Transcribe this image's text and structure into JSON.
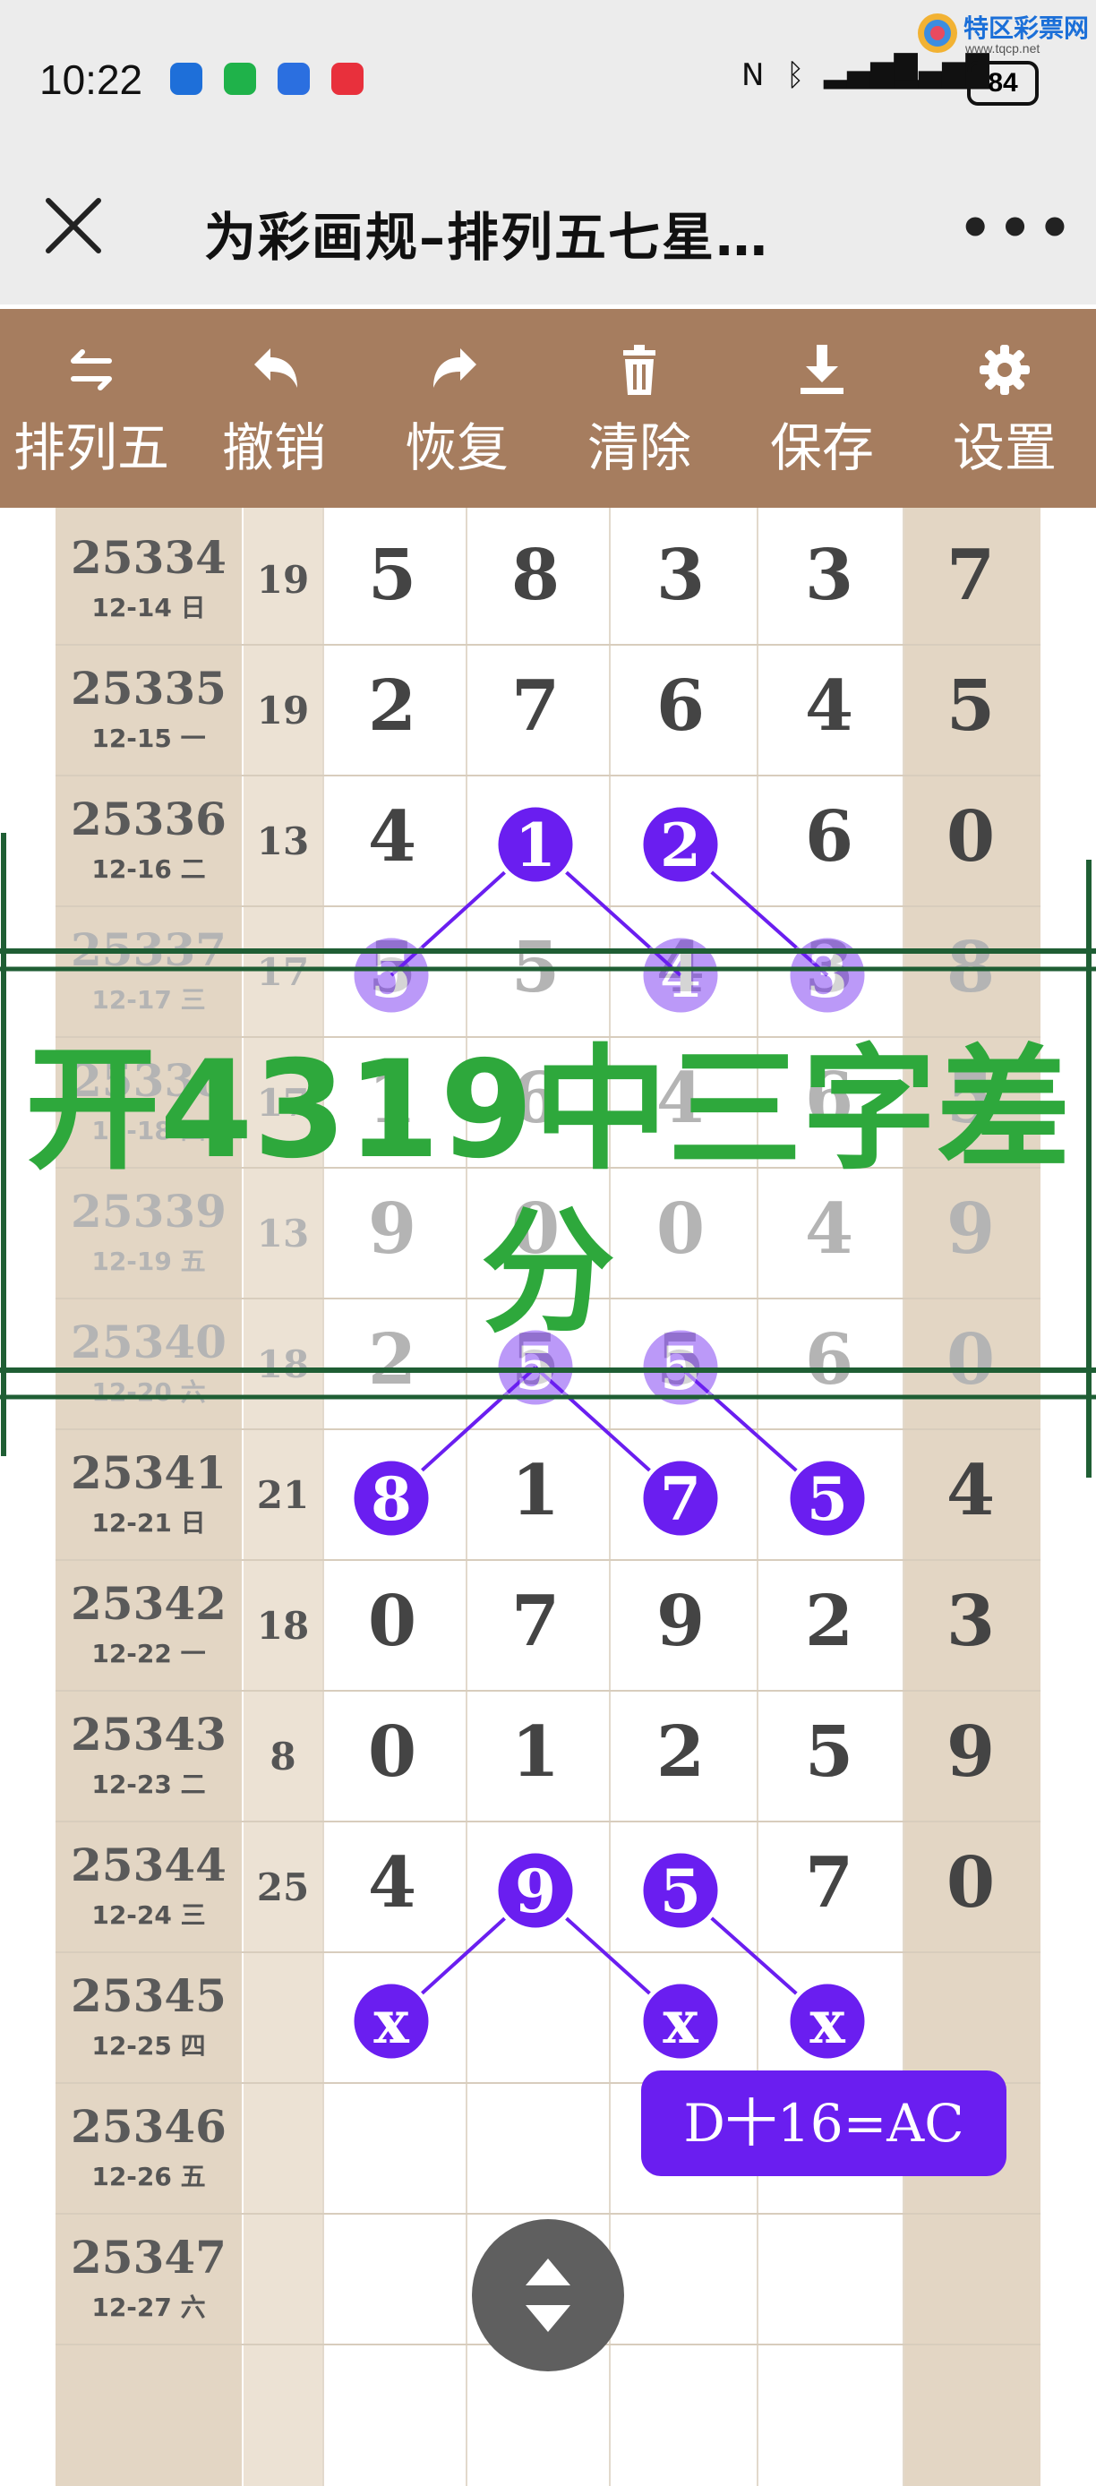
{
  "status": {
    "time": "10:22",
    "battery": "84"
  },
  "watermark": {
    "name": "特区彩票网",
    "url": "www.tqcp.net"
  },
  "header": {
    "title": "为彩画规–排列五七星…",
    "more": "•••"
  },
  "toolbar": [
    {
      "icon": "swap-icon",
      "label": "排列五"
    },
    {
      "icon": "undo-icon",
      "label": "撤销"
    },
    {
      "icon": "redo-icon",
      "label": "恢复"
    },
    {
      "icon": "trash-icon",
      "label": "清除"
    },
    {
      "icon": "download-icon",
      "label": "保存"
    },
    {
      "icon": "gear-icon",
      "label": "设置"
    }
  ],
  "rows": [
    {
      "issue": "25334",
      "date": "12-14 日",
      "sum": "19",
      "digits": [
        "5",
        "8",
        "3",
        "3",
        "7"
      ]
    },
    {
      "issue": "25335",
      "date": "12-15 一",
      "sum": "19",
      "digits": [
        "2",
        "7",
        "6",
        "4",
        "5"
      ]
    },
    {
      "issue": "25336",
      "date": "12-16 二",
      "sum": "13",
      "digits": [
        "4",
        "1",
        "2",
        "6",
        "0"
      ]
    },
    {
      "issue": "25337",
      "date": "12-17 三",
      "sum": "17",
      "digits": [
        "5",
        "5",
        "4",
        "3",
        "8"
      ]
    },
    {
      "issue": "25338",
      "date": "12-18 四",
      "sum": "17",
      "digits": [
        "1",
        "6",
        "4",
        "6",
        "5"
      ]
    },
    {
      "issue": "25339",
      "date": "12-19 五",
      "sum": "13",
      "digits": [
        "9",
        "0",
        "0",
        "4",
        "9"
      ]
    },
    {
      "issue": "25340",
      "date": "12-20 六",
      "sum": "18",
      "digits": [
        "2",
        "5",
        "5",
        "6",
        "0"
      ]
    },
    {
      "issue": "25341",
      "date": "12-21 日",
      "sum": "21",
      "digits": [
        "8",
        "1",
        "7",
        "5",
        "4"
      ]
    },
    {
      "issue": "25342",
      "date": "12-22 一",
      "sum": "18",
      "digits": [
        "0",
        "7",
        "9",
        "2",
        "3"
      ]
    },
    {
      "issue": "25343",
      "date": "12-23 二",
      "sum": "8",
      "digits": [
        "0",
        "1",
        "2",
        "5",
        "9"
      ]
    },
    {
      "issue": "25344",
      "date": "12-24 三",
      "sum": "25",
      "digits": [
        "4",
        "9",
        "5",
        "7",
        "0"
      ]
    },
    {
      "issue": "25345",
      "date": "12-25 四",
      "sum": "",
      "digits": [
        "x",
        "",
        "x",
        "x",
        ""
      ]
    },
    {
      "issue": "25346",
      "date": "12-26 五",
      "sum": "",
      "digits": [
        "",
        "",
        "",
        "",
        ""
      ]
    },
    {
      "issue": "25347",
      "date": "12-27 六",
      "sum": "",
      "digits": [
        "",
        "",
        "",
        "",
        ""
      ]
    }
  ],
  "banner": {
    "line1": "开4319中三字差",
    "line2": "分"
  },
  "formula": "D十16=AC",
  "colors": {
    "toolbar": "#a67d5f",
    "circle": "#6a1ef0",
    "banner_text": "#2ea83c",
    "banner_line": "#1f5e34"
  }
}
